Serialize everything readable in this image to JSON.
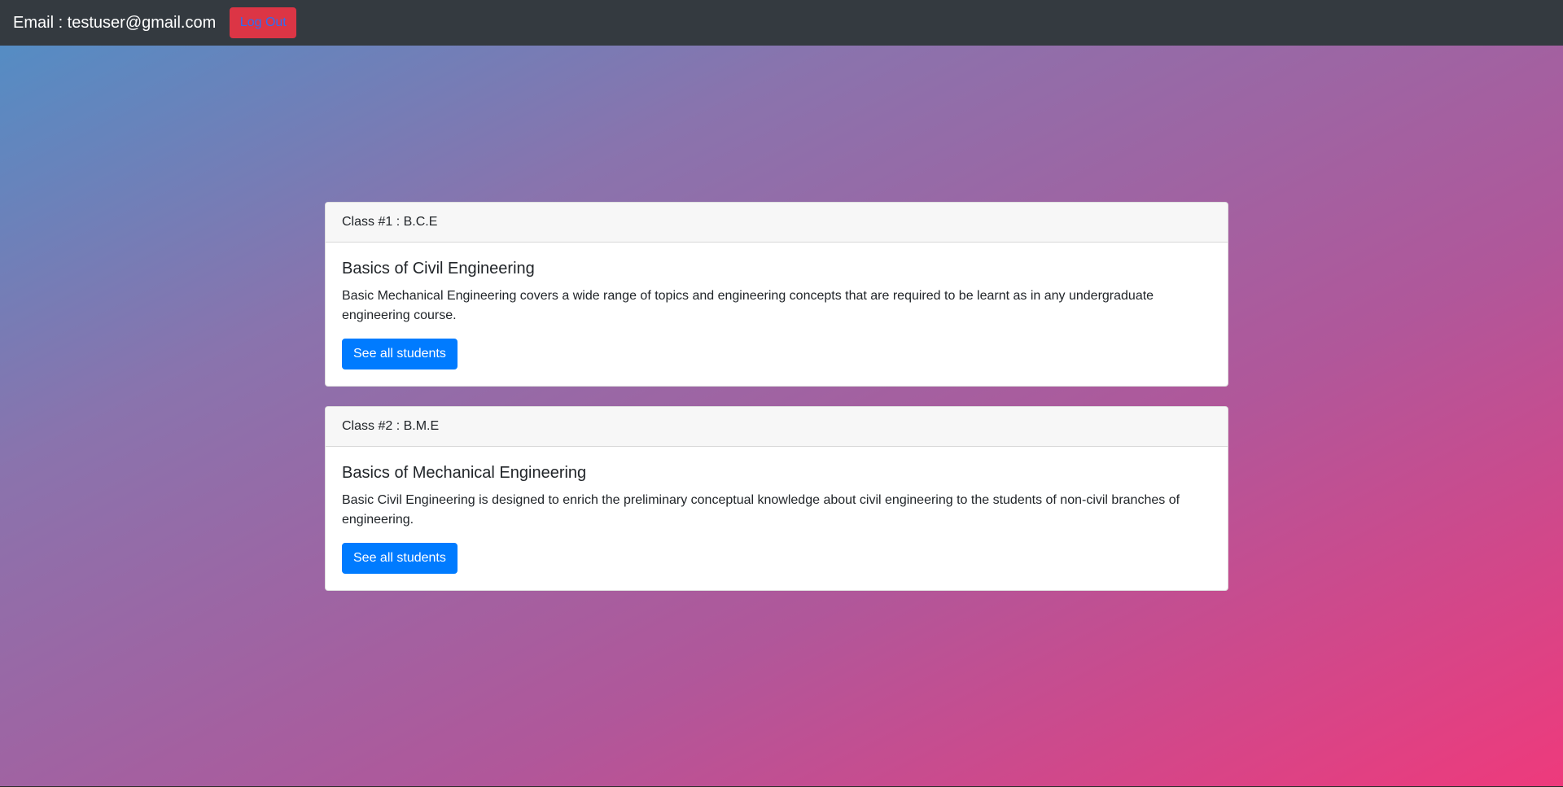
{
  "navbar": {
    "email_text": "Email : testuser@gmail.com",
    "logout_label": "Log Out"
  },
  "classes": [
    {
      "header": "Class #1 : B.C.E",
      "title": "Basics of Civil Engineering",
      "description": "Basic Mechanical Engineering covers a wide range of topics and engineering concepts that are required to be learnt as in any undergraduate engineering course.",
      "button_label": "See all students"
    },
    {
      "header": "Class #2 : B.M.E",
      "title": "Basics of Mechanical Engineering",
      "description": "Basic Civil Engineering is designed to enrich the preliminary conceptual knowledge about civil engineering to the students of non-civil branches of engineering.",
      "button_label": "See all students"
    }
  ],
  "colors": {
    "navbar_bg": "#343a40",
    "logout_bg": "#dc3545",
    "primary": "#007bff",
    "gradient_start": "#4f8fc6",
    "gradient_end": "#ee3a7c"
  }
}
